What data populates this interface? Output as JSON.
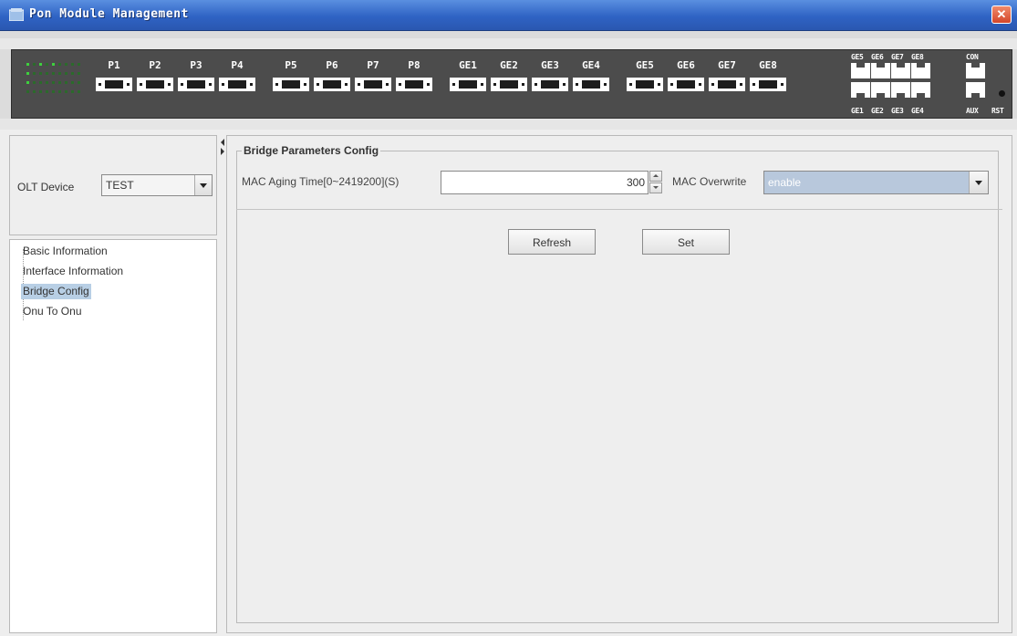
{
  "window": {
    "title": "Pon Module Management",
    "close_icon": "close-icon",
    "accent_color": "#2f63c4"
  },
  "device": {
    "pon_ports": [
      "P1",
      "P2",
      "P3",
      "P4",
      "P5",
      "P6",
      "P7",
      "P8"
    ],
    "ge_ports": [
      "GE1",
      "GE2",
      "GE3",
      "GE4",
      "GE5",
      "GE6",
      "GE7",
      "GE8"
    ],
    "rj45_top_labels": [
      "GE5",
      "GE6",
      "GE7",
      "GE8"
    ],
    "rj45_bottom_labels": [
      "GE1",
      "GE2",
      "GE3",
      "GE4"
    ],
    "console_top_label": "CON",
    "console_bottom_label": "AUX",
    "reset_label": "RST"
  },
  "sidebar": {
    "olt_label": "OLT Device",
    "olt_value": "TEST",
    "tree": [
      {
        "label": "Basic Information",
        "selected": false
      },
      {
        "label": "Interface Information",
        "selected": false
      },
      {
        "label": "Bridge Config",
        "selected": true
      },
      {
        "label": "Onu To Onu",
        "selected": false
      }
    ]
  },
  "main": {
    "group_title": "Bridge Parameters Config",
    "mac_aging_label": "MAC Aging Time[0~2419200](S)",
    "mac_aging_value": "300",
    "mac_overwrite_label": "MAC Overwrite",
    "mac_overwrite_value": "enable",
    "refresh_label": "Refresh",
    "set_label": "Set"
  }
}
